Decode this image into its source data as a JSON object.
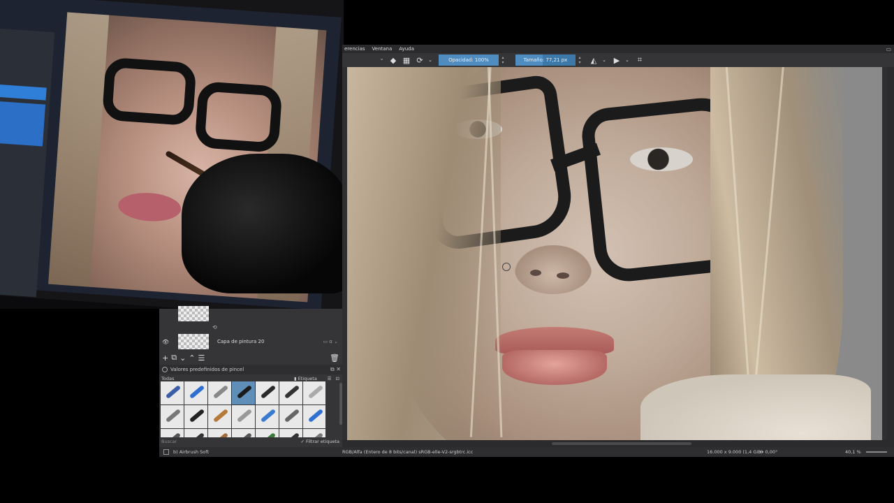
{
  "krita": {
    "menu": [
      "erencias",
      "Ventana",
      "Ayuda"
    ],
    "toolbar": {
      "opacity_label": "Opacidad: 100%",
      "opacity_fraction": 1.0,
      "size_label": "Tamaño: 77,21 px",
      "size_fraction": 0.45
    },
    "status": {
      "color_profile": "RGB/Alfa (Entero de 8 bits/canal)  sRGB-elle-V2-srgbtrc.icc",
      "dimensions": "16.000 x 9.000 (1,4 GiB)",
      "rotation": "0,00°",
      "zoom": "40,1 %"
    }
  },
  "layers_panel": {
    "layers": [
      {
        "name": ""
      },
      {
        "name": "Capa de pintura 20"
      }
    ],
    "brush_presets_title": "Valores predefinidos de pincel",
    "tag_filter": "Todas",
    "tag_label": "Etiqueta",
    "search_placeholder": "Buscar",
    "filter_tag_label": "Filtrar etiqueta",
    "current_brush": "b) Airbrush Soft",
    "brushes": [
      {
        "color": "#3a5fa8"
      },
      {
        "color": "#2f6fd0"
      },
      {
        "color": "#888888"
      },
      {
        "color": "#1a1a1a"
      },
      {
        "color": "#2a2a2a"
      },
      {
        "color": "#333333"
      },
      {
        "color": "#aaaaaa"
      },
      {
        "color": "#777777"
      },
      {
        "color": "#222222"
      },
      {
        "color": "#b57a3a"
      },
      {
        "color": "#999999"
      },
      {
        "color": "#3a7ad0"
      },
      {
        "color": "#666666"
      },
      {
        "color": "#2f6fd0"
      },
      {
        "color": "#555555"
      },
      {
        "color": "#333333"
      },
      {
        "color": "#a36b3a"
      },
      {
        "color": "#555555"
      },
      {
        "color": "#3a7a3a"
      },
      {
        "color": "#333333"
      },
      {
        "color": "#777777"
      }
    ],
    "selected_brush_index": 3
  },
  "photo_screen": {
    "opacity_label": "Opacidad 100%",
    "size_label": "Tamaño 77,21 px",
    "filter_label": "Filtrar etiqueta"
  }
}
